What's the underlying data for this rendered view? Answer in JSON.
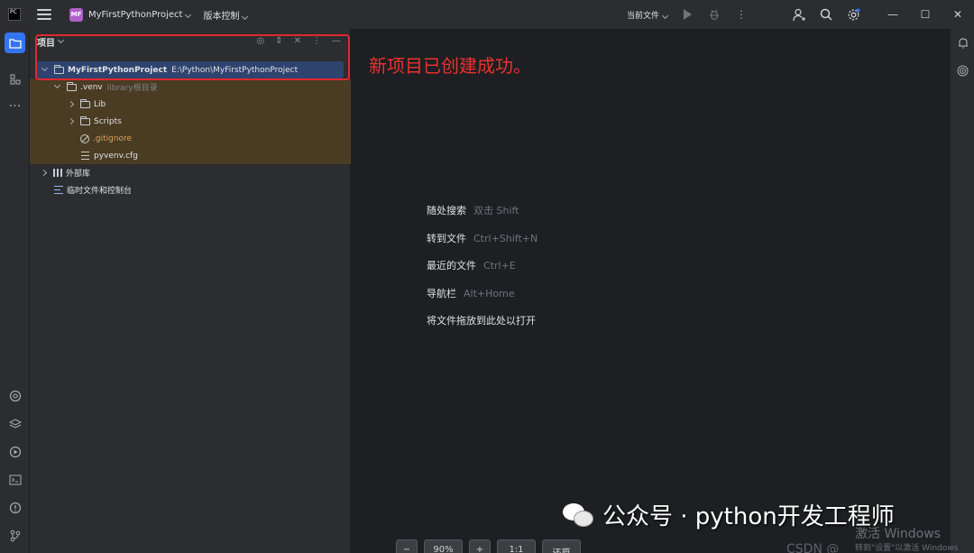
{
  "titlebar": {
    "logo_text": "PC",
    "project_badge": "MF",
    "project_name": "MyFirstPythonProject",
    "vcs_label": "版本控制",
    "run_config": "当前文件"
  },
  "project_panel": {
    "title": "项目",
    "root": {
      "name": "MyFirstPythonProject",
      "path": "E:\\Python\\MyFirstPythonProject"
    },
    "venv": {
      "name": ".venv",
      "note": "library根目录"
    },
    "children": [
      "Lib",
      "Scripts"
    ],
    "files": [
      ".gitignore",
      "pyvenv.cfg"
    ],
    "external_libs": "外部库",
    "scratches": "临时文件和控制台"
  },
  "annotation": {
    "text": "新项目已创建成功。",
    "color": "#e0282e"
  },
  "editor_hints": [
    {
      "label": "随处搜索",
      "shortcut": "双击 Shift"
    },
    {
      "label": "转到文件",
      "shortcut": "Ctrl+Shift+N"
    },
    {
      "label": "最近的文件",
      "shortcut": "Ctrl+E"
    },
    {
      "label": "导航栏",
      "shortcut": "Alt+Home"
    },
    {
      "label": "将文件拖放到此处以打开",
      "shortcut": ""
    }
  ],
  "watermarks": {
    "wechat": "公众号 · python开发工程师",
    "windows": "激活 Windows",
    "windows_sub": "转到\"设置\"以激活 Windows",
    "csdn": "CSDN @"
  },
  "zoom_bar": {
    "minus": "−",
    "zoom": "90%",
    "plus": "+",
    "one_to_one": "1:1",
    "restore": "还原"
  },
  "colors": {
    "accent": "#3574f0",
    "selection": "#2e436e",
    "excluded": "#4a3c23",
    "project_badge": "#b05fc9"
  }
}
